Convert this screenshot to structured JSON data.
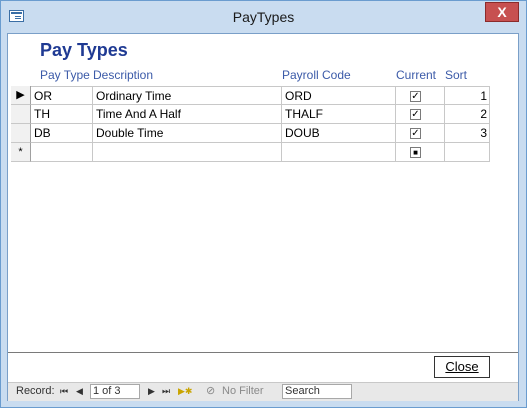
{
  "window": {
    "title": "PayTypes",
    "close_glyph": "X"
  },
  "form": {
    "heading": "Pay Types",
    "columns": {
      "pay_type": "Pay Type",
      "description": "Description",
      "payroll_code": "Payroll Code",
      "current": "Current",
      "sort": "Sort"
    },
    "rows": [
      {
        "pay_type": "OR",
        "description": "Ordinary Time",
        "payroll_code": "ORD",
        "current": true,
        "sort": "1"
      },
      {
        "pay_type": "TH",
        "description": "Time And A Half",
        "payroll_code": "THALF",
        "current": true,
        "sort": "2"
      },
      {
        "pay_type": "DB",
        "description": "Double Time",
        "payroll_code": "DOUB",
        "current": true,
        "sort": "3"
      }
    ],
    "new_record_marker": "*",
    "current_row_marker": "▶",
    "close_label": "Close"
  },
  "navigation": {
    "record_label": "Record:",
    "first": "⏮",
    "prev": "◀",
    "position": "1 of 3",
    "next": "▶",
    "last": "⏭",
    "new": "▶✱",
    "filter_label": "No Filter",
    "search_label": "Search"
  }
}
